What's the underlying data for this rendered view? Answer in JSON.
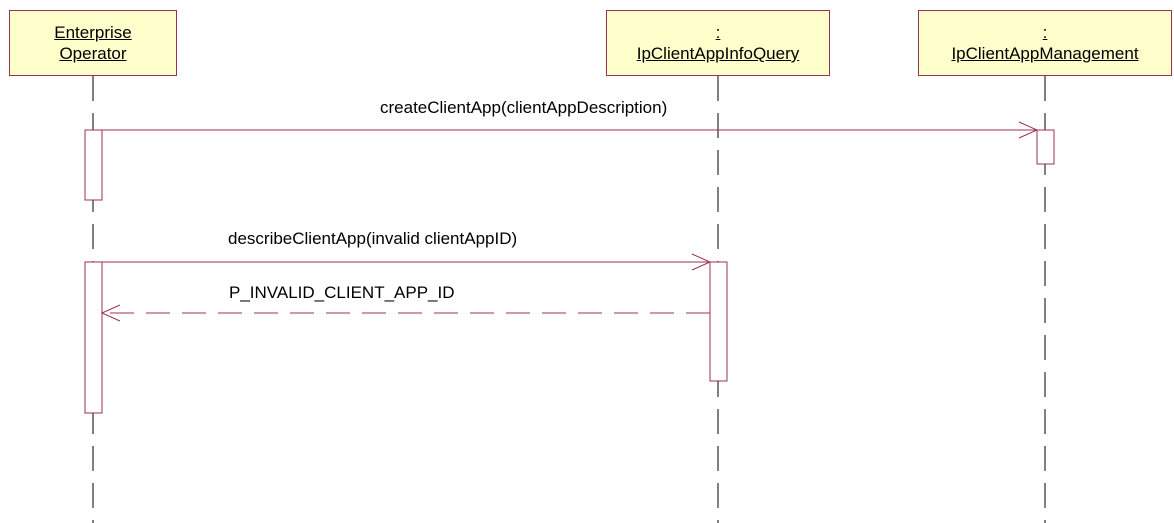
{
  "participants": [
    {
      "line1": "Enterprise",
      "line2": "Operator"
    },
    {
      "line1": ":",
      "line2": "IpClientAppInfoQuery"
    },
    {
      "line1": ":",
      "line2": "IpClientAppManagement"
    }
  ],
  "messages": [
    {
      "label": "createClientApp(clientAppDescription)",
      "kind": "call"
    },
    {
      "label": "describeClientApp(invalid clientAppID)",
      "kind": "call"
    },
    {
      "label": "P_INVALID_CLIENT_APP_ID",
      "kind": "return"
    }
  ],
  "colors": {
    "box_fill": "#ffffcc",
    "line": "#993355",
    "lifeline": "#000000"
  }
}
